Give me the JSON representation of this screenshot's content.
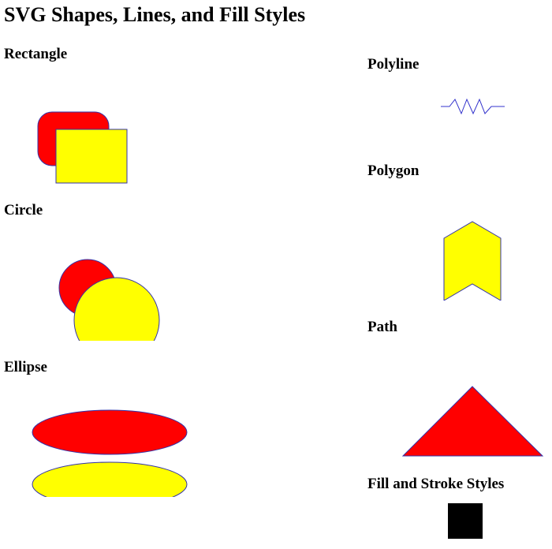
{
  "page": {
    "title": "SVG Shapes, Lines, and Fill Styles"
  },
  "sections": {
    "rectangle": {
      "heading": "Rectangle"
    },
    "circle": {
      "heading": "Circle"
    },
    "ellipse": {
      "heading": "Ellipse"
    },
    "polyline": {
      "heading": "Polyline"
    },
    "polygon": {
      "heading": "Polygon"
    },
    "path": {
      "heading": "Path"
    },
    "fill_stroke": {
      "heading": "Fill and Stroke Styles"
    }
  },
  "colors": {
    "red_fill": "#ff0000",
    "yellow_fill": "#ffff00",
    "stroke": "#3333aa",
    "black_fill": "#000000",
    "polyline_stroke": "#3333cc"
  }
}
